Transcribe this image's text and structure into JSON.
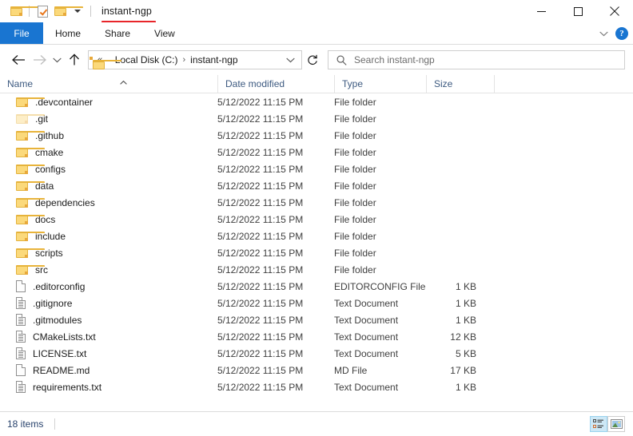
{
  "window": {
    "title": "instant-ngp",
    "quick_access": [
      {
        "name": "folder-icon",
        "label": "Folder"
      },
      {
        "name": "properties-icon",
        "label": "Properties"
      },
      {
        "name": "new-folder-icon",
        "label": "New folder"
      },
      {
        "name": "customize-qat-icon",
        "label": "Customize Quick Access Toolbar"
      }
    ],
    "controls": {
      "minimize": "Minimize",
      "maximize": "Maximize",
      "close": "Close"
    }
  },
  "ribbon": {
    "tabs": [
      {
        "label": "File",
        "active": true
      },
      {
        "label": "Home",
        "active": false
      },
      {
        "label": "Share",
        "active": false
      },
      {
        "label": "View",
        "active": false
      }
    ],
    "collapse_label": "Minimize the Ribbon",
    "help_label": "?"
  },
  "address": {
    "back_label": "Back",
    "forward_label": "Forward",
    "recent_label": "Recent locations",
    "up_label": "Up",
    "overflow": "«",
    "crumbs": [
      {
        "label": "Local Disk (C:)"
      },
      {
        "label": "instant-ngp"
      }
    ],
    "separator": "›",
    "refresh_label": "Refresh",
    "dropdown_label": "Previous locations"
  },
  "search": {
    "placeholder": "Search instant-ngp"
  },
  "columns": [
    {
      "key": "name",
      "label": "Name",
      "sorted": "asc"
    },
    {
      "key": "date",
      "label": "Date modified"
    },
    {
      "key": "type",
      "label": "Type"
    },
    {
      "key": "size",
      "label": "Size"
    }
  ],
  "files": [
    {
      "name": ".devcontainer",
      "date": "5/12/2022 11:15 PM",
      "type": "File folder",
      "size": "",
      "icon": "folder",
      "dim": false
    },
    {
      "name": ".git",
      "date": "5/12/2022 11:15 PM",
      "type": "File folder",
      "size": "",
      "icon": "folder",
      "dim": true
    },
    {
      "name": ".github",
      "date": "5/12/2022 11:15 PM",
      "type": "File folder",
      "size": "",
      "icon": "folder",
      "dim": false
    },
    {
      "name": "cmake",
      "date": "5/12/2022 11:15 PM",
      "type": "File folder",
      "size": "",
      "icon": "folder",
      "dim": false
    },
    {
      "name": "configs",
      "date": "5/12/2022 11:15 PM",
      "type": "File folder",
      "size": "",
      "icon": "folder",
      "dim": false
    },
    {
      "name": "data",
      "date": "5/12/2022 11:15 PM",
      "type": "File folder",
      "size": "",
      "icon": "folder",
      "dim": false
    },
    {
      "name": "dependencies",
      "date": "5/12/2022 11:15 PM",
      "type": "File folder",
      "size": "",
      "icon": "folder",
      "dim": false
    },
    {
      "name": "docs",
      "date": "5/12/2022 11:15 PM",
      "type": "File folder",
      "size": "",
      "icon": "folder",
      "dim": false
    },
    {
      "name": "include",
      "date": "5/12/2022 11:15 PM",
      "type": "File folder",
      "size": "",
      "icon": "folder",
      "dim": false
    },
    {
      "name": "scripts",
      "date": "5/12/2022 11:15 PM",
      "type": "File folder",
      "size": "",
      "icon": "folder",
      "dim": false
    },
    {
      "name": "src",
      "date": "5/12/2022 11:15 PM",
      "type": "File folder",
      "size": "",
      "icon": "folder",
      "dim": false
    },
    {
      "name": ".editorconfig",
      "date": "5/12/2022 11:15 PM",
      "type": "EDITORCONFIG File",
      "size": "1 KB",
      "icon": "file-blank",
      "dim": false
    },
    {
      "name": ".gitignore",
      "date": "5/12/2022 11:15 PM",
      "type": "Text Document",
      "size": "1 KB",
      "icon": "file-text",
      "dim": false
    },
    {
      "name": ".gitmodules",
      "date": "5/12/2022 11:15 PM",
      "type": "Text Document",
      "size": "1 KB",
      "icon": "file-text",
      "dim": false
    },
    {
      "name": "CMakeLists.txt",
      "date": "5/12/2022 11:15 PM",
      "type": "Text Document",
      "size": "12 KB",
      "icon": "file-text",
      "dim": false
    },
    {
      "name": "LICENSE.txt",
      "date": "5/12/2022 11:15 PM",
      "type": "Text Document",
      "size": "5 KB",
      "icon": "file-text",
      "dim": false
    },
    {
      "name": "README.md",
      "date": "5/12/2022 11:15 PM",
      "type": "MD File",
      "size": "17 KB",
      "icon": "file-blank",
      "dim": false
    },
    {
      "name": "requirements.txt",
      "date": "5/12/2022 11:15 PM",
      "type": "Text Document",
      "size": "1 KB",
      "icon": "file-text",
      "dim": false
    }
  ],
  "status": {
    "item_count": "18 items",
    "view_details_label": "Details view",
    "view_large_icons_label": "Large icons view"
  },
  "annotations": {
    "color": "#e8252a",
    "marks": [
      {
        "name": "title-underline",
        "target": "instant-ngp"
      },
      {
        "name": "breadcrumb-underline",
        "target": "Local Disk (C:) › instant-ngp"
      }
    ]
  }
}
